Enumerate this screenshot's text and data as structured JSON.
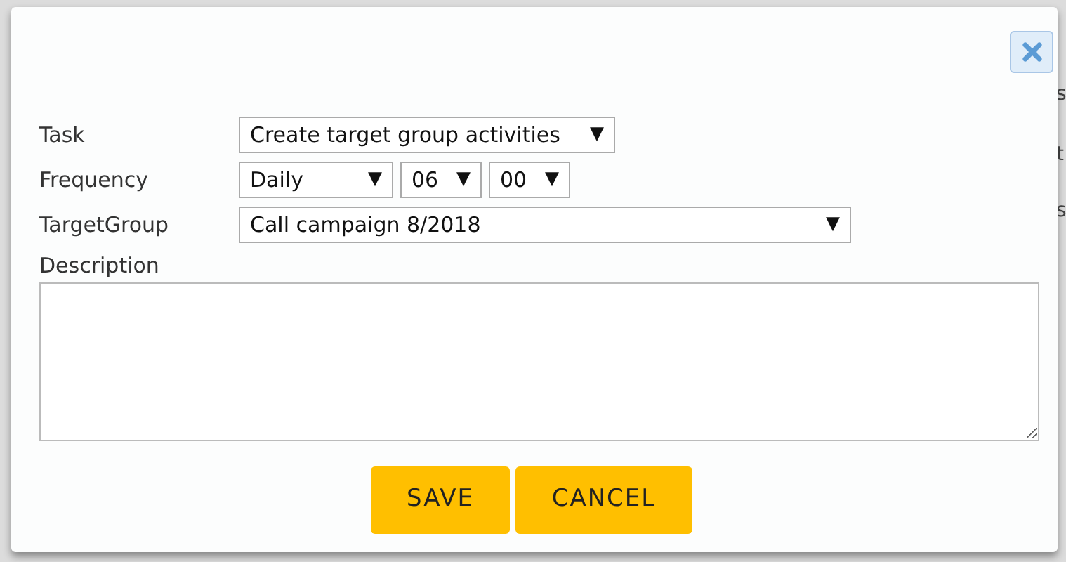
{
  "background": {
    "edge_fragments": [
      "s",
      "t",
      "s"
    ]
  },
  "dialog": {
    "fields": [
      {
        "label": "Task",
        "kind": "select",
        "selects": [
          {
            "value": "Create target group activities",
            "arrow": "▼"
          }
        ]
      },
      {
        "label": "Frequency",
        "kind": "select",
        "selects": [
          {
            "value": "Daily",
            "arrow": "▼"
          },
          {
            "value": "06",
            "arrow": "▼"
          },
          {
            "value": "00",
            "arrow": "▼"
          }
        ]
      },
      {
        "label": "TargetGroup",
        "kind": "select",
        "selects": [
          {
            "value": "Call campaign 8/2018",
            "arrow": "▼"
          }
        ]
      },
      {
        "label": "Description",
        "kind": "textarea"
      }
    ],
    "buttons": [
      "SAVE",
      "CANCEL"
    ]
  }
}
